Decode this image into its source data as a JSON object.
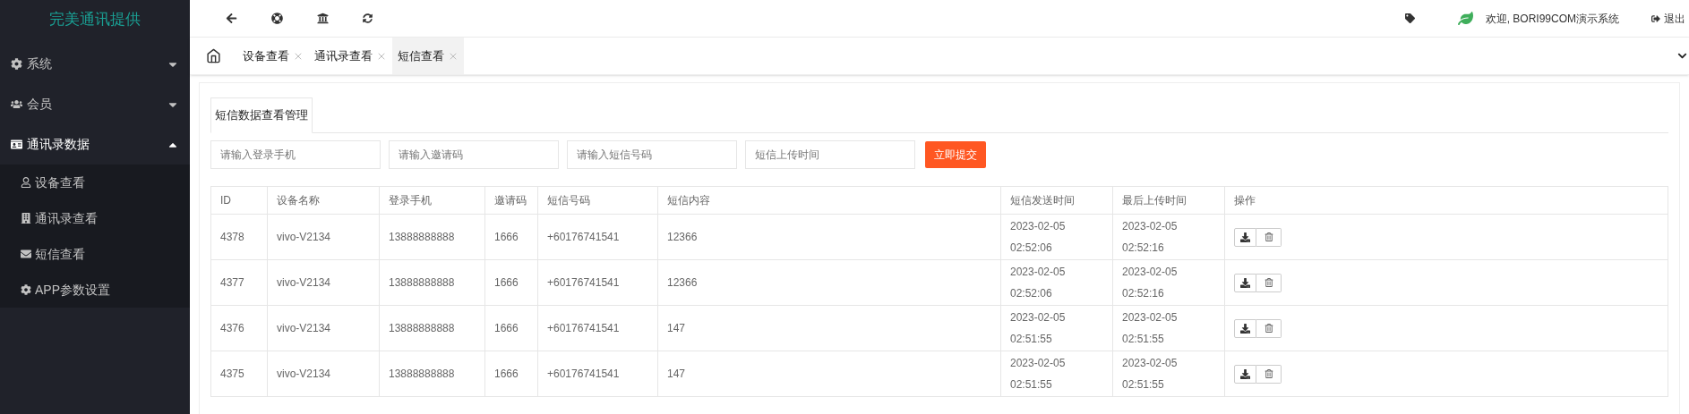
{
  "sidebar": {
    "title": "完美通讯提供",
    "menu": [
      {
        "label": "系统",
        "expanded": false
      },
      {
        "label": "会员",
        "expanded": false
      },
      {
        "label": "通讯录数据",
        "expanded": true,
        "children": [
          {
            "label": "设备查看"
          },
          {
            "label": "通讯录查看"
          },
          {
            "label": "短信查看"
          },
          {
            "label": "APP参数设置"
          }
        ]
      }
    ]
  },
  "topbar": {
    "welcome": "欢迎, BORI99COM演示系统",
    "logout": "退出"
  },
  "tabs": [
    {
      "label": "设备查看",
      "selected": false
    },
    {
      "label": "通讯录查看",
      "selected": false
    },
    {
      "label": "短信查看",
      "selected": true
    }
  ],
  "panel": {
    "tab": "短信数据查看管理",
    "filters": [
      {
        "placeholder": "请输入登录手机"
      },
      {
        "placeholder": "请输入邀请码"
      },
      {
        "placeholder": "请输入短信号码"
      },
      {
        "placeholder": "短信上传时间"
      }
    ],
    "submit": "立即提交"
  },
  "table": {
    "columns": [
      "ID",
      "设备名称",
      "登录手机",
      "邀请码",
      "短信号码",
      "短信内容",
      "短信发送时间",
      "最后上传时间",
      "操作"
    ],
    "rows": [
      {
        "cells": [
          "4378",
          "vivo-V2134",
          "13888888888",
          "1666",
          "+60176741541",
          "12366",
          "2023-02-05 02:52:06",
          "2023-02-05 02:52:16"
        ]
      },
      {
        "cells": [
          "4377",
          "vivo-V2134",
          "13888888888",
          "1666",
          "+60176741541",
          "12366",
          "2023-02-05 02:52:06",
          "2023-02-05 02:52:16"
        ]
      },
      {
        "cells": [
          "4376",
          "vivo-V2134",
          "13888888888",
          "1666",
          "+60176741541",
          "147",
          "2023-02-05 02:51:55",
          "2023-02-05 02:51:55"
        ]
      },
      {
        "cells": [
          "4375",
          "vivo-V2134",
          "13888888888",
          "1666",
          "+60176741541",
          "147",
          "2023-02-05 02:51:55",
          "2023-02-05 02:51:55"
        ]
      }
    ]
  }
}
